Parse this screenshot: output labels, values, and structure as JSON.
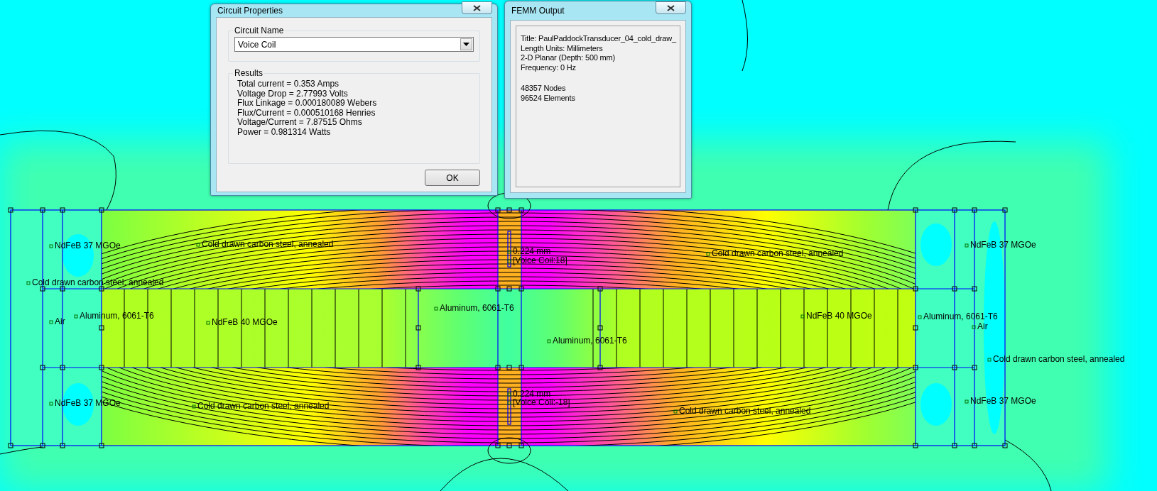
{
  "circuit_properties": {
    "title": "Circuit Properties",
    "circuit_name_label": "Circuit Name",
    "circuit_name_value": "Voice Coil",
    "results_label": "Results",
    "results": [
      "Total current = 0.353 Amps",
      "Voltage Drop = 2.77993 Volts",
      "Flux Linkage = 0.000180089 Webers",
      "Flux/Current = 0.000510168 Henries",
      "Voltage/Current = 7.87515 Ohms",
      "Power = 0.981314 Watts"
    ],
    "ok_button": "OK"
  },
  "femm_output": {
    "title": "FEMM Output",
    "info": [
      "Title: PaulPaddockTransducer_04_cold_draw_",
      "Length Units: Millimeters",
      "2-D Planar (Depth: 500 mm)",
      "Frequency: 0 Hz"
    ],
    "stats": [
      "48357 Nodes",
      "96524 Elements"
    ]
  },
  "plot": {
    "labels": [
      {
        "text": "NdFeB 37 MGOe"
      },
      {
        "text": "Cold drawn carbon steel, annealed"
      },
      {
        "text": "Air"
      },
      {
        "text": "Aluminum, 6061-T6"
      },
      {
        "text": "NdFeB 40 MGOe"
      },
      {
        "text": "NdFeB 37 MGOe"
      },
      {
        "text": "Cold drawn carbon steel, annealed"
      },
      {
        "text": "Cold drawn carbon steel, annealed"
      },
      {
        "text": "0.224 mm"
      },
      {
        "text": "[Voice Coil:18]"
      },
      {
        "text": "Aluminum, 6061-T6"
      },
      {
        "text": "Aluminum, 6061-T6"
      },
      {
        "text": "Cold drawn carbon steel, annealed"
      },
      {
        "text": "0.224 mm"
      },
      {
        "text": "[Voice Coil:-18]"
      },
      {
        "text": "Cold drawn carbon steel, annealed"
      },
      {
        "text": "NdFeB 37 MGOe"
      },
      {
        "text": "NdFeB 40 MGOe"
      },
      {
        "text": "Aluminum, 6061-T6"
      },
      {
        "text": "Air"
      },
      {
        "text": "Cold drawn carbon steel, annealed"
      },
      {
        "text": "NdFeB 37 MGOe"
      }
    ]
  }
}
